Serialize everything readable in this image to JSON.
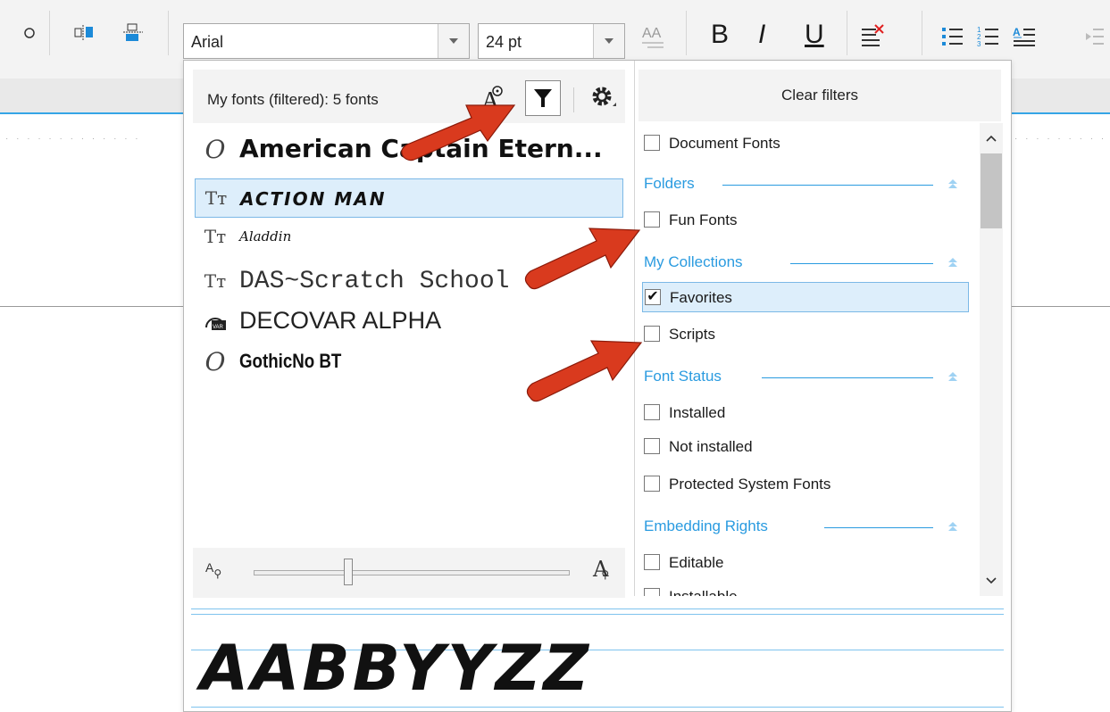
{
  "toolbar": {
    "font_name": "Arial",
    "font_size": "24 pt",
    "bold_label": "B",
    "italic_label": "I",
    "underline_label": "U",
    "icons": [
      "circle-icon",
      "align-objects-icon",
      "distribute-icon",
      "text-case-icon",
      "clear-format-icon",
      "bullet-list-icon",
      "numbered-list-icon",
      "drop-cap-icon",
      "indent-icon"
    ]
  },
  "font_popup": {
    "header_title": "My fonts (filtered): 5 fonts",
    "clear_filters": "Clear filters",
    "fonts": [
      {
        "name": "American Captain Etern...",
        "type_icon": "opentype-icon"
      },
      {
        "name": "ACTION MAN",
        "type_icon": "truetype-icon",
        "selected": true
      },
      {
        "name": "Aladdin",
        "type_icon": "truetype-icon"
      },
      {
        "name": "DAS~Scratch School",
        "type_icon": "truetype-icon"
      },
      {
        "name": "DECOVAR ALPHA",
        "type_icon": "variable-font-icon"
      },
      {
        "name": "GothicNo BT",
        "type_icon": "opentype-icon"
      }
    ],
    "slider_level": 0.3
  },
  "filters": {
    "document_fonts": "Document Fonts",
    "groups": {
      "folders": "Folders",
      "my_collections": "My Collections",
      "font_status": "Font Status",
      "embedding_rights": "Embedding Rights"
    },
    "items": {
      "fun_fonts": "Fun Fonts",
      "favorites": "Favorites",
      "scripts": "Scripts",
      "installed": "Installed",
      "not_installed": "Not installed",
      "protected": "Protected System Fonts",
      "editable": "Editable",
      "installable": "Installable"
    },
    "checked": [
      "Favorites"
    ]
  },
  "preview": {
    "sample_text": "AABBYYZZ"
  },
  "colors": {
    "accent": "#2a9be0",
    "selection_bg": "#ddeefb",
    "annotation_arrow": "#d93a1e"
  }
}
